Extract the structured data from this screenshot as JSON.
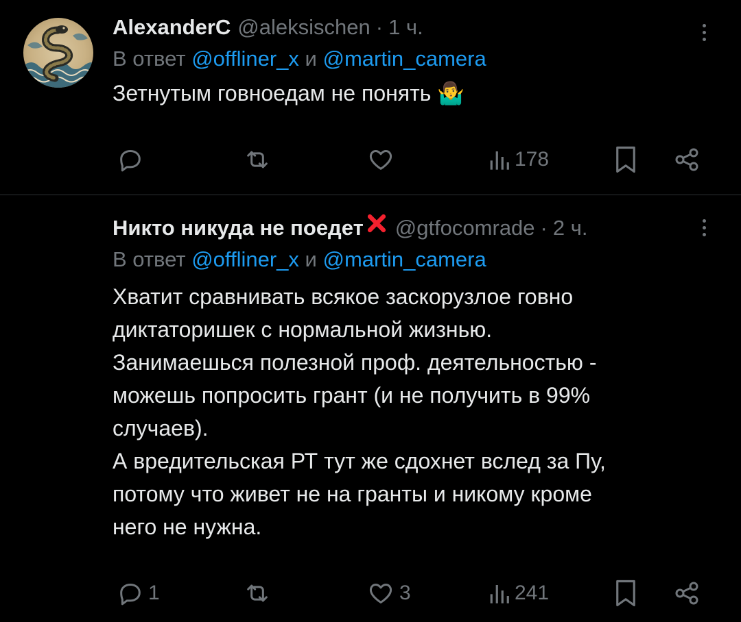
{
  "colors": {
    "background": "#000000",
    "text": "#e7e9ea",
    "muted": "#71767b",
    "link": "#1d9bf0",
    "divider": "#2f3336",
    "cross": "#f4212e"
  },
  "tweets": [
    {
      "name": "AlexanderC",
      "handle": "@aleksischen",
      "separator": "·",
      "time": "1 ч.",
      "reply_prefix": "В ответ",
      "mention1": "@offliner_x",
      "conjunction": "и",
      "mention2": "@martin_camera",
      "text": "Зетнутым говноедам не понять 🤷‍♂️",
      "icons": {
        "avatar": "snake-avatar-icon",
        "more": "more-icon"
      },
      "actions": {
        "reply_count": "",
        "retweet_count": "",
        "like_count": "",
        "views_count": "178"
      }
    },
    {
      "name": "Никто никуда не поедет",
      "name_emoji": "cross-mark-icon",
      "handle": "@gtfocomrade",
      "separator": "·",
      "time": "2 ч.",
      "reply_prefix": "В ответ",
      "mention1": "@offliner_x",
      "conjunction": "и",
      "mention2": "@martin_camera",
      "text_lines": [
        "Хватит сравнивать всякое заскорузлое говно",
        "диктаторишек с нормальной жизнью.",
        "Занимаешься полезной проф. деятельностью -",
        "можешь попросить грант (и не получить в 99%",
        "случаев).",
        "А вредительская РТ тут же сдохнет вслед за Пу,",
        "потому что живет не на гранты и никому кроме",
        "него не нужна."
      ],
      "icons": {
        "more": "more-icon"
      },
      "actions": {
        "reply_count": "1",
        "retweet_count": "",
        "like_count": "3",
        "views_count": "241"
      }
    }
  ]
}
